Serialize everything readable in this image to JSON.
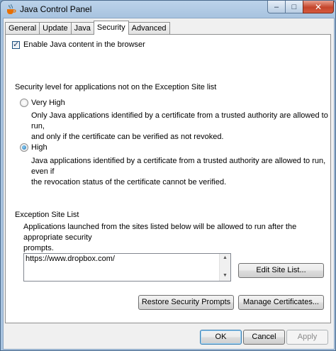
{
  "window": {
    "title": "Java Control Panel"
  },
  "title_buttons": {
    "minimize": "–",
    "maximize": "□",
    "close": "✕"
  },
  "tabs": [
    {
      "label": "General"
    },
    {
      "label": "Update"
    },
    {
      "label": "Java"
    },
    {
      "label": "Security"
    },
    {
      "label": "Advanced"
    }
  ],
  "enable_java": {
    "label": "Enable Java content in the browser",
    "checked": true
  },
  "security_level": {
    "heading": "Security level for applications not on the Exception Site list",
    "options": [
      {
        "label": "Very High",
        "selected": false,
        "desc_line1": "Only Java applications identified by a certificate from a trusted authority are allowed to run,",
        "desc_line2": "and only if the certificate can be verified as not revoked."
      },
      {
        "label": "High",
        "selected": true,
        "desc_line1": "Java applications identified by a certificate from a trusted authority are allowed to run, even if",
        "desc_line2": "the revocation status of the certificate cannot be verified."
      }
    ]
  },
  "exception_site_list": {
    "heading": "Exception Site List",
    "desc_line1": "Applications launched from the sites listed below will be allowed to run after the appropriate security",
    "desc_line2": "prompts.",
    "sites": [
      "https://www.dropbox.com/"
    ],
    "edit_button": "Edit Site List..."
  },
  "buttons": {
    "restore_prompts": "Restore Security Prompts",
    "manage_certificates": "Manage Certificates...",
    "ok": "OK",
    "cancel": "Cancel",
    "apply": "Apply"
  }
}
